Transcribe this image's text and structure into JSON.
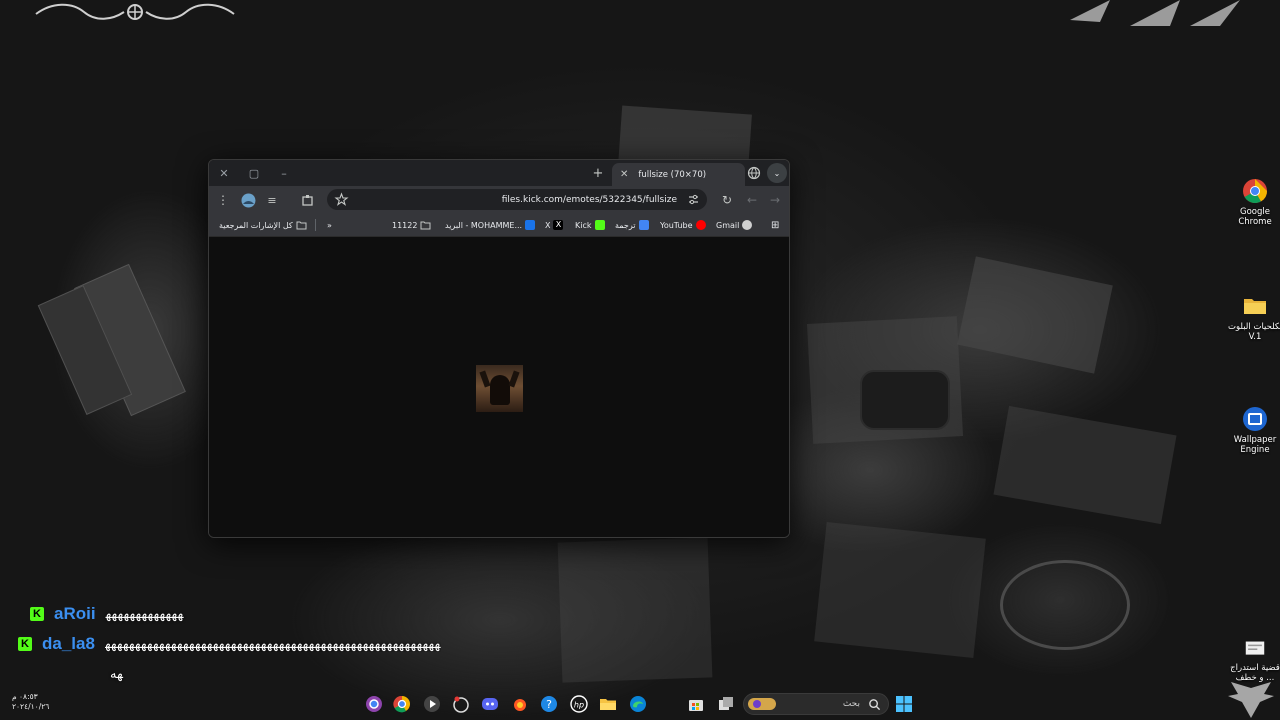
{
  "browser": {
    "tab": {
      "title": "fullsize (70×70)"
    },
    "address": "files.kick.com/emotes/5322345/fullsize",
    "bookmarks": [
      {
        "label": "Gmail",
        "icon": "gmail-icon"
      },
      {
        "label": "YouTube",
        "icon": "youtube-icon"
      },
      {
        "label": "ترجمة",
        "icon": "translate-icon"
      },
      {
        "label": "Kick",
        "icon": "kick-icon"
      },
      {
        "label": "X",
        "icon": "x-icon"
      },
      {
        "label": "البريد - MOHAMME...",
        "icon": "outlook-icon"
      },
      {
        "label": "11122",
        "icon": "folder-icon"
      }
    ],
    "all_bookmarks": "كل الإشارات المرجعية"
  },
  "desktop_icons": [
    {
      "label": "Google Chrome",
      "icon": "chrome-icon"
    },
    {
      "label": "تكلحيات البلوت V.1",
      "icon": "folder-icon"
    },
    {
      "label": "Wallpaper Engine",
      "icon": "wallpaper-engine-icon"
    },
    {
      "label": "قضية استدراج ... و خطف",
      "icon": "document-icon"
    }
  ],
  "chat": [
    {
      "user": "aRoii",
      "message": "ﻬﻬﻬﻬﻬﻬﻬﻬﻬﻬﻬﻬﻬ"
    },
    {
      "user": "da_la8",
      "message": "ﻬﻬﻬﻬﻬﻬﻬﻬﻬﻬﻬﻬﻬﻬﻬﻬﻬﻬﻬﻬﻬﻬﻬﻬﻬﻬﻬﻬﻬﻬﻬﻬﻬﻬﻬﻬﻬﻬﻬﻬﻬﻬﻬﻬﻬﻬﻬﻬﻬﻬﻬﻬﻬﻬﻬﻬ"
    },
    {
      "user": "",
      "message": "ﻬﻪ"
    }
  ],
  "taskbar": {
    "search_placeholder": "بحث"
  },
  "clock": {
    "time": "٠٨:٥٣ م",
    "date": "٢٠٢٤/١٠/٢٦"
  },
  "colors": {
    "kick_green": "#53fc18",
    "chat_user": "#3b8ff0"
  }
}
